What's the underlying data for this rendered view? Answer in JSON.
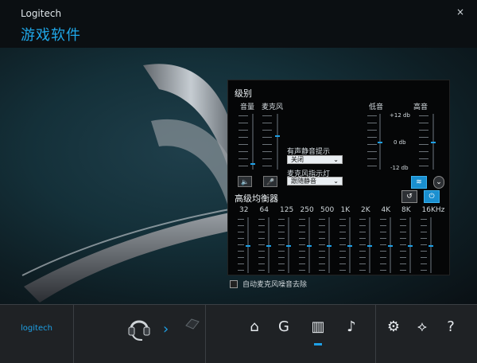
{
  "window": {
    "brand": "Logitech",
    "product": "游戏软件",
    "close_icon": "×"
  },
  "panel": {
    "title": "级别",
    "labels": {
      "volume": "音量",
      "mic": "麦克风",
      "bass": "低音",
      "treble": "高音"
    },
    "bass_db_labels": [
      "+12 db",
      "0 db",
      "-12 db"
    ],
    "mute_prompt": {
      "label": "有声静音提示",
      "selected": "关闭"
    },
    "mic_indicator": {
      "label": "麦克风指示灯",
      "selected": "跟随静音"
    },
    "levels": {
      "volume": 0.12,
      "mic": 0.62,
      "bass": 0.5,
      "treble": 0.5
    }
  },
  "eq": {
    "title": "高级均衡器",
    "freqs": [
      "32",
      "64",
      "125",
      "250",
      "500",
      "1K",
      "2K",
      "4K",
      "8K",
      "16KHz"
    ],
    "levels": [
      0.5,
      0.5,
      0.5,
      0.5,
      0.5,
      0.5,
      0.5,
      0.5,
      0.5,
      0.5
    ]
  },
  "noise_reduction": {
    "label": "自动麦克风噪音去除"
  },
  "bottom": {
    "logo_text": "logitech"
  }
}
